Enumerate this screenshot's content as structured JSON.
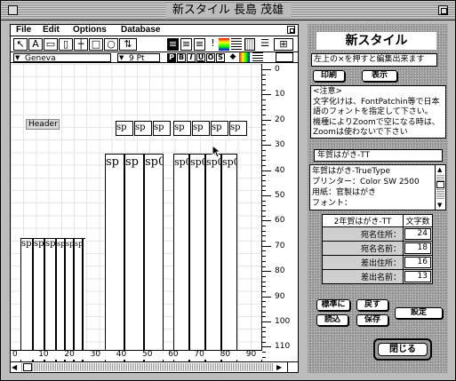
{
  "window": {
    "title": "新スタイル 長島 茂雄"
  },
  "menu": [
    "File",
    "Edit",
    "Options",
    "Database"
  ],
  "format": {
    "font": "Geneva",
    "size": "9 Pt",
    "styles": [
      "P",
      "B",
      "I",
      "U",
      "O",
      "S"
    ]
  },
  "canvas": {
    "header_label": "Header",
    "sp_label": "sp",
    "sp_clipped_label": "sp0"
  },
  "ruler": {
    "vertical": [
      "0",
      "10",
      "20",
      "30",
      "40",
      "50",
      "60",
      "70",
      "80",
      "90",
      "100",
      "110"
    ],
    "horizontal": [
      "0",
      "10",
      "20",
      "30",
      "40",
      "50",
      "60",
      "70",
      "80",
      "90"
    ]
  },
  "panel": {
    "title": "新スタイル",
    "hint": "左上の×を押すと編集出来ます",
    "print_button": "印刷",
    "display_button": "表示",
    "note": "<注意>\n文字化けは、FontPatchin等で日本語のフォントを指定して下さい。\n機種によりZoomで空になる時は、Zoomは使わないで下さい",
    "template_name": "年賀はがき-TT",
    "info_lines": [
      "年賀はがき-TrueType",
      "プリンター：Color SW 2500",
      "用紙：官製はがき",
      "フォント："
    ],
    "table_header": [
      "2年賀はがき-TT",
      "文字数"
    ],
    "rows": [
      {
        "label": "宛名住所：",
        "value": "24"
      },
      {
        "label": "宛名名前：",
        "value": "18"
      },
      {
        "label": "差出住所：",
        "value": "16"
      },
      {
        "label": "差出名前：",
        "value": "13"
      }
    ],
    "buttons": {
      "standard": "標準に",
      "back": "戻す",
      "read": "読込",
      "save": "保存",
      "settings": "設定",
      "close": "閉じる"
    }
  }
}
